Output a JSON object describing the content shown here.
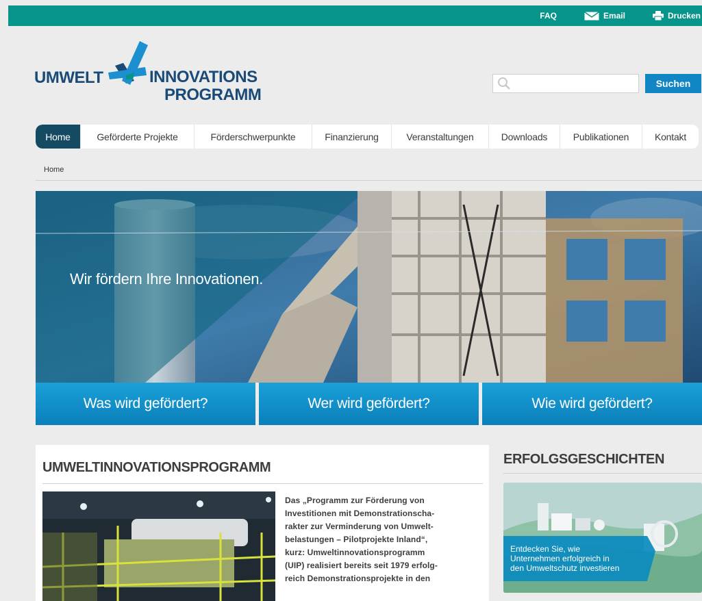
{
  "topbar": {
    "faq": "FAQ",
    "email": "Email",
    "print": "Drucken"
  },
  "logo": {
    "word1": "UMWELT",
    "word2": "INNOVATIONS",
    "word3": "PROGRAMM"
  },
  "search": {
    "placeholder": "",
    "button": "Suchen"
  },
  "nav": {
    "items": [
      "Home",
      "Geförderte Projekte",
      "Förderschwerpunkte",
      "Finanzierung",
      "Veranstaltungen",
      "Downloads",
      "Publikationen",
      "Kontakt"
    ],
    "active": "Home"
  },
  "breadcrumb": "Home",
  "hero": {
    "tagline": "Wir fördern Ihre Innovationen."
  },
  "ctas": [
    "Was wird gefördert?",
    "Wer wird gefördert?",
    "Wie wird gefördert?"
  ],
  "main": {
    "title": "UMWELTINNOVATIONSPROGRAMM",
    "lines": [
      "Das „Programm zur Förderung von",
      "Investitionen mit Demonstrationscha-",
      "rakter zur Verminderung von Umwelt-",
      "belastungen – Pilotprojekte Inland“,",
      "kurz: Umweltinnovationsprogramm",
      "(UIP) realisiert bereits seit 1979 erfolg-",
      "reich Demonstrationsprojekte in den"
    ]
  },
  "sidebar": {
    "title": "ERFOLGSGESCHICHTEN",
    "caption": [
      "Entdecken Sie, wie",
      "Unternehmen erfolgreich in",
      "den Umweltschutz investieren"
    ]
  },
  "colors": {
    "topbar": "#07948a",
    "nav_active": "#154a63",
    "button": "#1186c4",
    "logo_blue": "#1a4a78"
  }
}
